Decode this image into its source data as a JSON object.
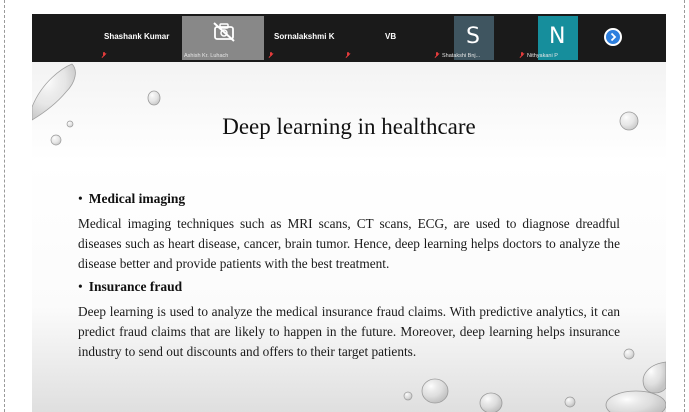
{
  "participants": [
    {
      "name": "Shashank Kumar",
      "status": "muted"
    },
    {
      "name": "Ashish Kr. Luhach",
      "status": "video-off"
    },
    {
      "name": "Sornalakshmi K",
      "status": "muted"
    },
    {
      "name": "VB",
      "status": "muted"
    },
    {
      "name": "Shatakshi Bnj...",
      "initial": "S",
      "status": "muted"
    },
    {
      "name": "Nithyakani P",
      "initial": "N",
      "status": "muted"
    }
  ],
  "colors": {
    "strip": "#1a1a1a",
    "tile_gray": "#888888",
    "tile_s": "#3f5560",
    "tile_n": "#168e9c",
    "next_button": "#2d7fde"
  },
  "slide": {
    "title": "Deep learning in healthcare",
    "sections": [
      {
        "heading": "Medical imaging",
        "body": "Medical imaging techniques such as MRI scans, CT scans, ECG, are used to diagnose dreadful diseases such as heart disease, cancer, brain tumor. Hence, deep learning helps doctors to analyze the disease better and provide patients with the best treatment."
      },
      {
        "heading": "Insurance fraud",
        "body": "Deep learning is used to analyze the medical insurance fraud claims. With predictive analytics, it can predict fraud claims that are likely to happen in the future. Moreover, deep learning helps insurance industry to send out discounts and offers to their target patients."
      }
    ]
  }
}
